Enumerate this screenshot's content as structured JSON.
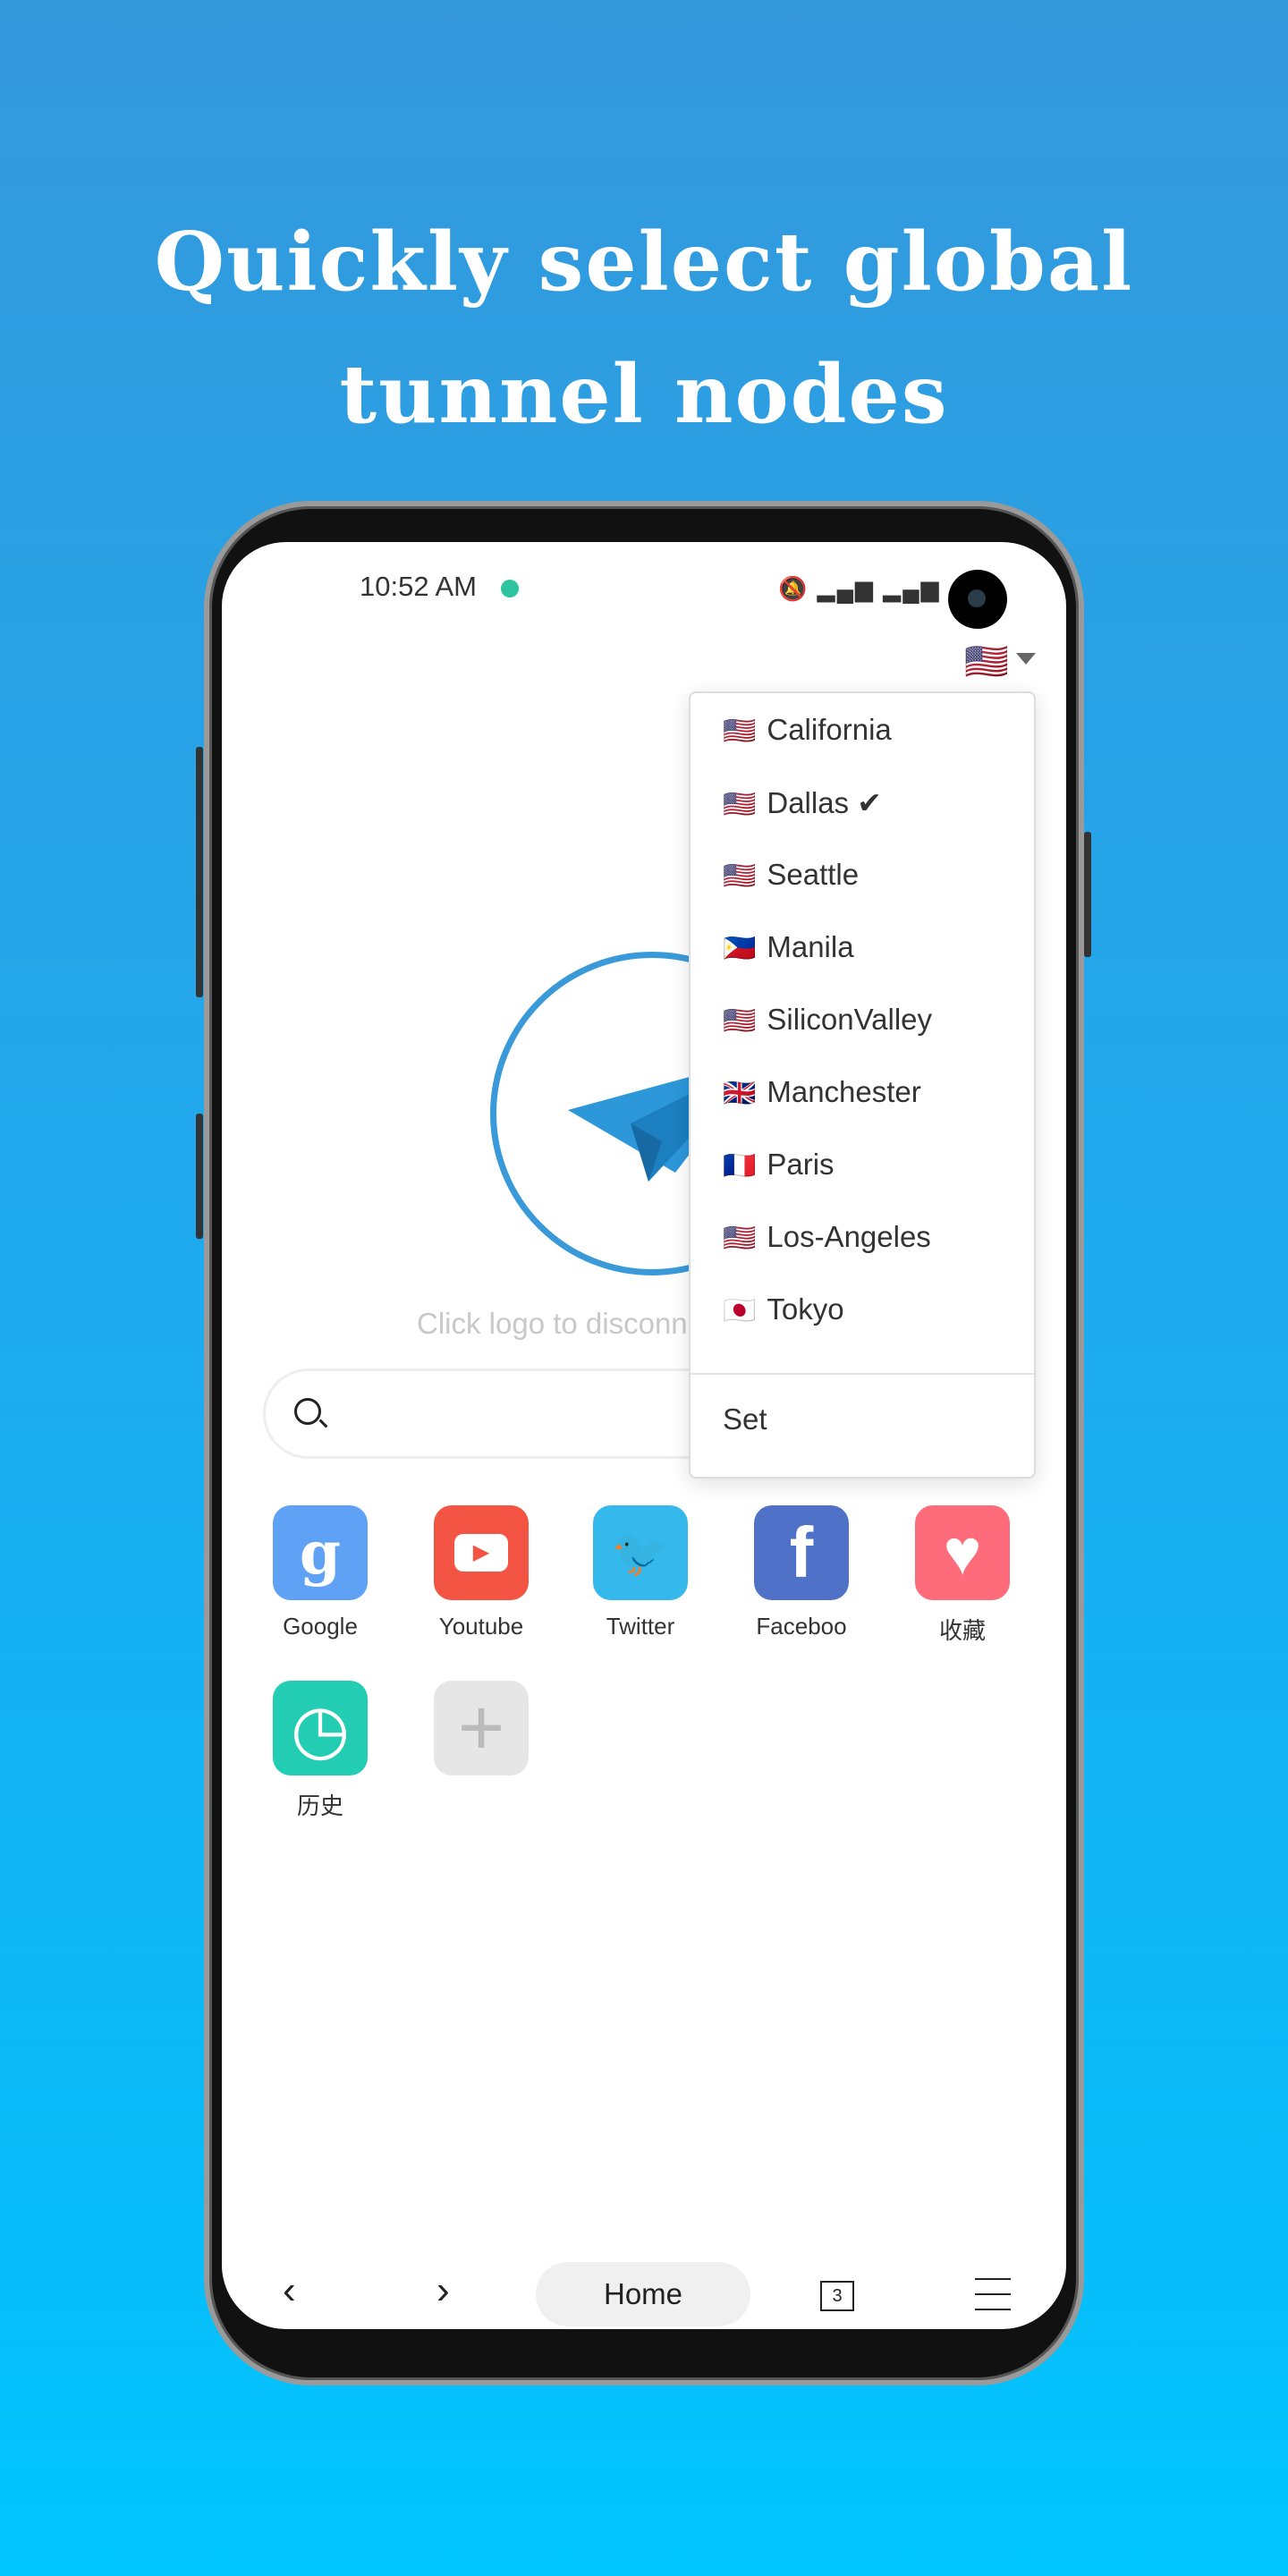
{
  "headline": {
    "line1": "Quickly select global",
    "line2": "tunnel nodes"
  },
  "status_bar": {
    "time": "10:52 AM",
    "icons": [
      "mute-icon",
      "hd-signal-icon",
      "hd-signal-icon",
      "wifi-icon",
      "battery-icon"
    ]
  },
  "header": {
    "selected_flag": "🇺🇸"
  },
  "main": {
    "hint": "Click logo to disconn",
    "search_placeholder": ""
  },
  "node_menu": {
    "items": [
      {
        "flag": "🇺🇸",
        "label": "California",
        "check": ""
      },
      {
        "flag": "🇺🇸",
        "label": "Dallas",
        "check": "✔"
      },
      {
        "flag": "🇺🇸",
        "label": "Seattle",
        "check": ""
      },
      {
        "flag": "🇵🇭",
        "label": "Manila",
        "check": ""
      },
      {
        "flag": "🇺🇸",
        "label": "SiliconValley",
        "check": ""
      },
      {
        "flag": "🇬🇧",
        "label": "Manchester",
        "check": ""
      },
      {
        "flag": "🇫🇷",
        "label": "Paris",
        "check": ""
      },
      {
        "flag": "🇺🇸",
        "label": "Los-Angeles",
        "check": ""
      },
      {
        "flag": "🇯🇵",
        "label": "Tokyo",
        "check": ""
      }
    ],
    "set_label": "Set"
  },
  "shortcuts": [
    {
      "label": "Google",
      "glyph": "g",
      "color": "#5fa2f5"
    },
    {
      "label": "Youtube",
      "glyph": "▶",
      "color": "#f45444"
    },
    {
      "label": "Twitter",
      "glyph": "🐦",
      "color": "#35b8ec"
    },
    {
      "label": "Faceboo",
      "glyph": "f",
      "color": "#4f72c8"
    },
    {
      "label": "收藏",
      "glyph": "♥",
      "color": "#fe6b7b"
    },
    {
      "label": "历史",
      "glyph": "◷",
      "color": "#22cdb3"
    },
    {
      "label": "",
      "glyph": "+",
      "color": "#e6e6e6"
    }
  ],
  "bottom_nav": {
    "back": "‹",
    "forward": "›",
    "home": "Home",
    "tab_count": "3"
  },
  "colors": {
    "accent": "#3a9ad9",
    "bg_top": "#3498db",
    "bg_bottom": "#00c4fe"
  }
}
